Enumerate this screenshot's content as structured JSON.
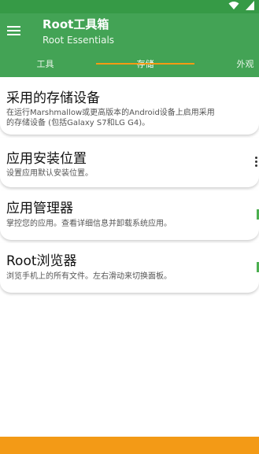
{
  "colors": {
    "status_bar": "#369a46",
    "app_bar": "#43a355",
    "tab_indicator": "#f59a13",
    "bottom_bar": "#f39a16"
  },
  "status_bar": {
    "icons": [
      "wifi-icon",
      "signal-icon"
    ]
  },
  "app_bar": {
    "title": "Root工具箱",
    "subtitle": "Root Essentials",
    "menu_icon": "menu-icon"
  },
  "tabs": [
    {
      "label": "工具",
      "selected": false
    },
    {
      "label": "存储",
      "selected": true
    },
    {
      "label": "外观",
      "selected": false
    }
  ],
  "items": [
    {
      "title": "采用的存储设备",
      "desc_line1": "在运行Marshmallow或更高版本的Android设备上启用采用",
      "desc_line2": "的存储设备 (包括Galaxy S7和LG G4)。"
    },
    {
      "title": "应用安装位置",
      "desc_line1": "设置应用默认安装位置。"
    },
    {
      "title": "应用管理器",
      "desc_line1": "掌控您的应用。查看详细信息并卸载系统应用。"
    },
    {
      "title": "Root浏览器",
      "desc_line1": "浏览手机上的所有文件。左右滑动来切换面板。"
    }
  ]
}
